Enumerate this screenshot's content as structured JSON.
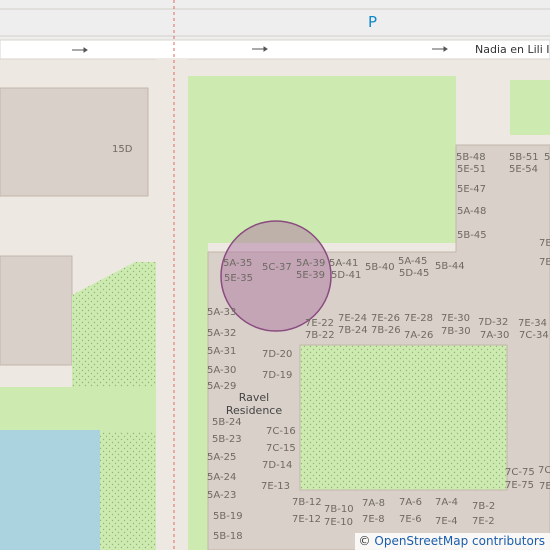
{
  "map": {
    "street_name": "Nadia en Lili I",
    "parking_symbol": "P",
    "place_name_line1": "Ravel",
    "place_name_line2": "Residence",
    "attribution_symbol": "©",
    "attribution_text": "OpenStreetMap contributors",
    "colors": {
      "background": "#ede9e2",
      "building": "#d9d0c9",
      "building_stroke": "#c4b6ab",
      "grass": "#cdebb0",
      "water": "#aad3df",
      "road": "#ffffff",
      "marker_fill": "#b382a6",
      "marker_stroke": "#8a4b80"
    },
    "building_labels": [
      "15D",
      "5B-48",
      "5E-51",
      "5B-51",
      "5E-54",
      "5E-47",
      "5A-48",
      "5B-45",
      "5A-35",
      "5E-35",
      "5C-37",
      "5A-39",
      "5E-39",
      "5A-41",
      "5D-41",
      "5B-40",
      "5A-45",
      "5D-45",
      "5B-44",
      "5A-33",
      "5A-32",
      "5A-31",
      "5A-30",
      "5A-29",
      "7E-22",
      "7B-22",
      "7E-24",
      "7B-24",
      "7E-26",
      "7B-26",
      "7E-28",
      "7A-26",
      "7E-30",
      "7B-30",
      "7D-32",
      "7A-30",
      "7E-34",
      "7C-34",
      "7D-20",
      "7D-19",
      "5B-24",
      "5B-23",
      "5A-25",
      "5A-24",
      "5A-23",
      "5B-19",
      "5B-18",
      "7C-16",
      "7C-15",
      "7D-14",
      "7E-13",
      "7B-12",
      "7E-12",
      "7B-10",
      "7E-10",
      "7A-8",
      "7E-8",
      "7A-6",
      "7E-6",
      "7A-4",
      "7E-4",
      "7B-2",
      "7E-2",
      "7C-75",
      "7E-75",
      "7C",
      "7E",
      "7B",
      "7B",
      "5"
    ]
  }
}
